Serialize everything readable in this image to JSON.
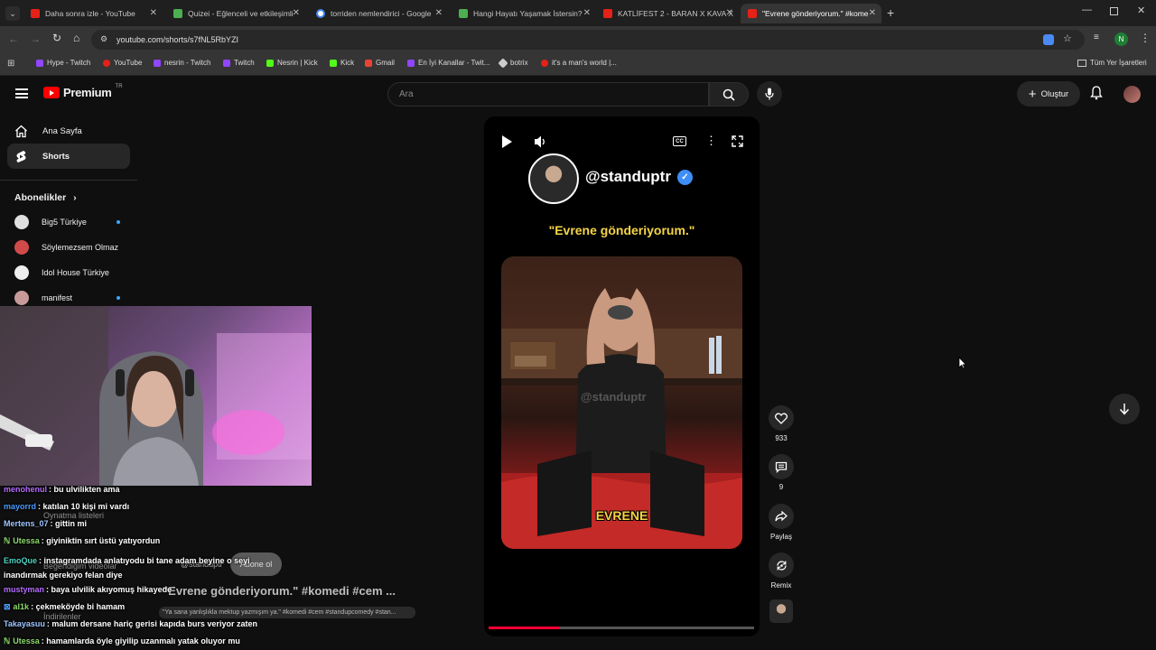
{
  "browser": {
    "tabs": [
      {
        "label": "Daha sonra izle - YouTube",
        "color": "#e62117"
      },
      {
        "label": "Quizei - Eğlenceli ve etkileşimli",
        "color": "#4caf50"
      },
      {
        "label": "torriden nemlendirici - Google",
        "color": "#4285f4"
      },
      {
        "label": "Hangi Hayatı Yaşamak İstersin?",
        "color": "#4caf50"
      },
      {
        "label": "KATLİFEST 2 - BARAN X KAVA X",
        "color": "#e62117"
      },
      {
        "label": "\"Evrene gönderiyorum.\" #kome",
        "color": "#e62117"
      }
    ],
    "url": "youtube.com/shorts/s7fNL5RbYZI",
    "profile_initial": "N",
    "bookmarks": [
      {
        "label": "Hype - Twitch",
        "color": "#9146ff"
      },
      {
        "label": "YouTube",
        "color": "#e62117"
      },
      {
        "label": "nesrin - Twitch",
        "color": "#9146ff"
      },
      {
        "label": "Twitch",
        "color": "#9146ff"
      },
      {
        "label": "Nesrin | Kick",
        "color": "#53fc18"
      },
      {
        "label": "Kick",
        "color": "#53fc18"
      },
      {
        "label": "Gmail",
        "color": "#ea4335"
      },
      {
        "label": "En İyi Kanallar - Twit...",
        "color": "#9146ff"
      },
      {
        "label": "botrix",
        "color": "#cccccc"
      },
      {
        "label": "it's a man's world |...",
        "color": "#e62117"
      }
    ],
    "all_bookmarks": "Tüm Yer İşaretleri"
  },
  "youtube": {
    "logo": "Premium",
    "region": "TR",
    "search_placeholder": "Ara",
    "create": "Oluştur",
    "sidebar": {
      "home": "Ana Sayfa",
      "shorts": "Shorts",
      "subscriptions": "Abonelikler",
      "subs": [
        {
          "name": "Big5 Türkiye",
          "dot": true,
          "color": "#e0e0e0"
        },
        {
          "name": "Söylemezsem Olmaz",
          "dot": false,
          "color": "#d04a4a"
        },
        {
          "name": "Idol House Türkiye",
          "dot": false,
          "color": "#eeeeee"
        },
        {
          "name": "manifest",
          "dot": true,
          "color": "#c89a9a"
        }
      ]
    },
    "short": {
      "channel": "@standuptr",
      "quote": "\"Evrene gönderiyorum.\"",
      "watermark": "@standuptr",
      "subtitle": "EVRENE",
      "likes": "933",
      "comments": "9",
      "share": "Paylaş",
      "remix": "Remix",
      "progress": 0.27
    },
    "behind": {
      "title": "\"Evrene gönderiyorum.\" #komedi #cem ...",
      "desc": "\"Ya sana yanlışlıkla mektup yazmışım ya.\" #komedi #cem #standupcomedy #stan...",
      "channel": "@standuptr",
      "subscribe": "Abone ol",
      "menu1": "Oynatma listeleri",
      "menu2": "Beğendiğim videolar",
      "menu3": "İndirilenler"
    }
  },
  "chat": [
    {
      "user": "menohenul",
      "msg": ": bu ulvilikten ama",
      "color": "#b76cff"
    },
    {
      "user": "mayorrd",
      "msg": ": katılan 10 kişi mi vardı",
      "color": "#4a9bff"
    },
    {
      "user": "Mertens_07",
      "msg": ": gittin mi",
      "color": "#9fc5ff"
    },
    {
      "user": "Utessa",
      "msg": ": giyiniktin sırt üstü yatıyordun",
      "color": "#8cd96b"
    },
    {
      "user": "EmoQue",
      "msg": ": instagramdada anlatıyodu bi tane adam beyine o seyi inandırmak gerekiyo felan diye",
      "color": "#4ed3c4"
    },
    {
      "user": "mustyman",
      "msg": ": baya ulvilik akıyomuş hikayede",
      "color": "#b76cff"
    },
    {
      "user": "al1k",
      "msg": ": çekmeköyde bi hamam",
      "color": "#8cd96b"
    },
    {
      "user": "Takayasuu",
      "msg": ": malum dersane hariç gerisi kapıda burs veriyor zaten",
      "color": "#9fc5ff"
    },
    {
      "user": "Utessa",
      "msg": ": hamamlarda öyle giyilip uzanmalı yatak oluyor mu",
      "color": "#8cd96b"
    }
  ]
}
